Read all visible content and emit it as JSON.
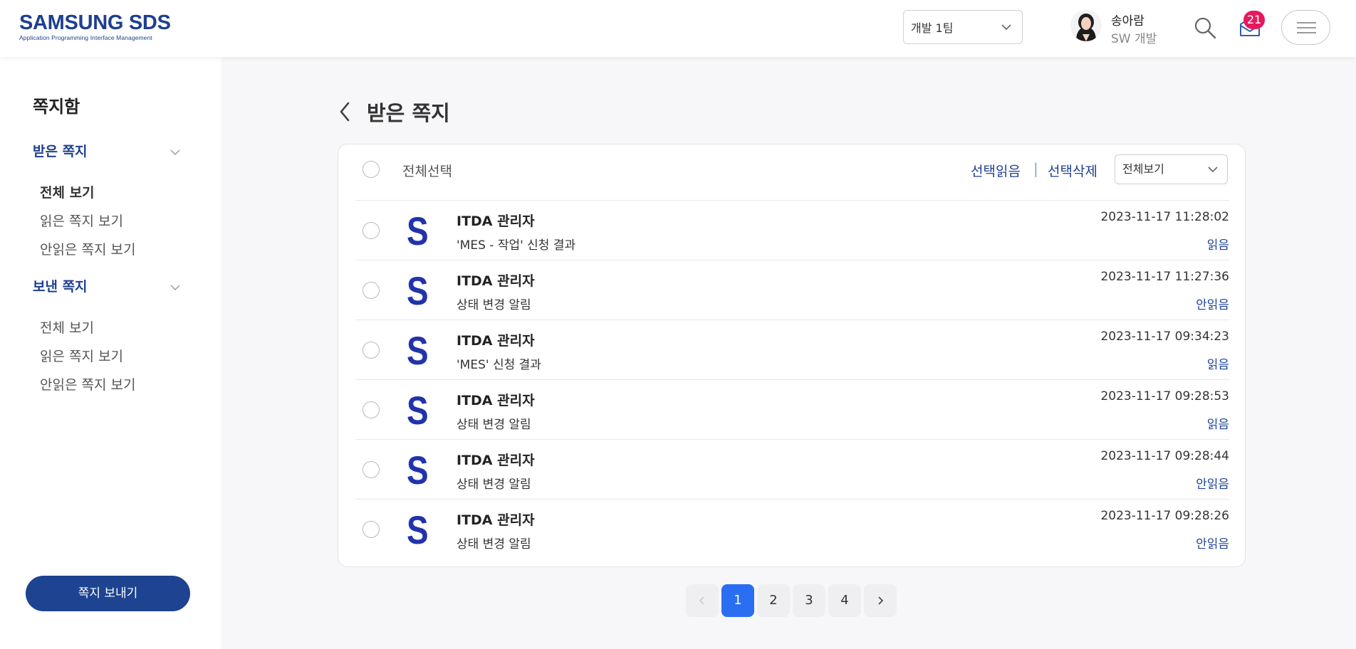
{
  "header": {
    "logo_main": "SAMSUNG SDS",
    "logo_sub": "Application Programming Interface Management",
    "team_select": "개발 1팀",
    "user_name": "송아람",
    "user_dept": "SW 개발",
    "message_badge": "21",
    "icons": [
      "search-icon",
      "message-icon",
      "hamburger-menu-icon"
    ]
  },
  "sidebar": {
    "title": "쪽지함",
    "groups": [
      {
        "label": "받은 쪽지",
        "items": [
          "전체 보기",
          "읽은 쪽지 보기",
          "안읽은 쪽지 보기"
        ]
      },
      {
        "label": "보낸 쪽지",
        "items": [
          "전체 보기",
          "읽은 쪽지 보기",
          "안읽은 쪽지 보기"
        ]
      }
    ],
    "send_button": "쪽지 보내기"
  },
  "main": {
    "title": "받은 쪽지",
    "toolbar": {
      "select_all": "전체선택",
      "mark_read": "선택읽음",
      "separator": "|",
      "delete": "선택삭제",
      "view_filter": "전체보기"
    },
    "messages": [
      {
        "sender": "ITDA 관리자",
        "subject": "'MES - 작업' 신청 결과",
        "date": "2023-11-17 11:28:02",
        "status": "읽음"
      },
      {
        "sender": "ITDA 관리자",
        "subject": "상태 변경 알림",
        "date": "2023-11-17 11:27:36",
        "status": "안읽음"
      },
      {
        "sender": "ITDA 관리자",
        "subject": "'MES' 신청 결과",
        "date": "2023-11-17 09:34:23",
        "status": "읽음"
      },
      {
        "sender": "ITDA 관리자",
        "subject": "상태 변경 알림",
        "date": "2023-11-17 09:28:53",
        "status": "읽음"
      },
      {
        "sender": "ITDA 관리자",
        "subject": "상태 변경 알림",
        "date": "2023-11-17 09:28:44",
        "status": "안읽음"
      },
      {
        "sender": "ITDA 관리자",
        "subject": "상태 변경 알림",
        "date": "2023-11-17 09:28:26",
        "status": "안읽음"
      }
    ],
    "sender_logo_letter": "S",
    "pagination": {
      "pages": [
        "1",
        "2",
        "3",
        "4"
      ],
      "current": "1"
    }
  },
  "colors": {
    "brand": "#1d3f8f",
    "accent": "#2a6ef2",
    "badge": "#e5195e"
  }
}
